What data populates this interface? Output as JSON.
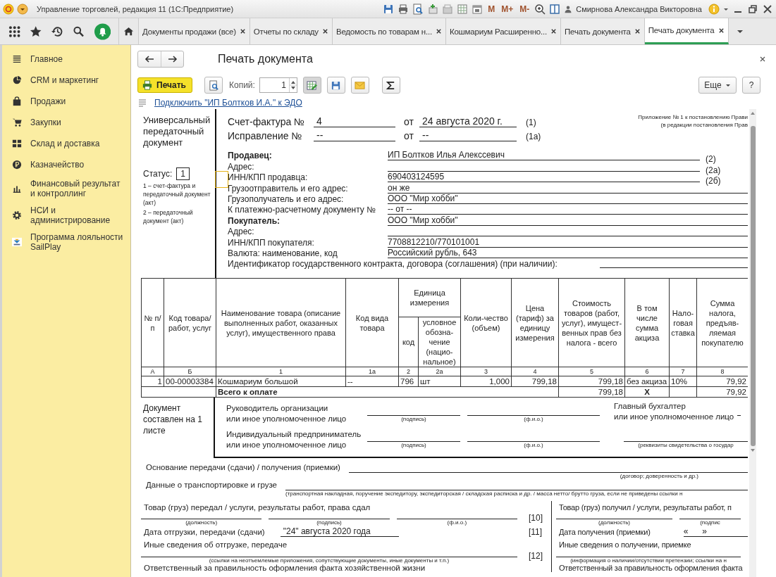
{
  "window": {
    "title": "Управление торговлей, редакция 11 (1С:Предприятие)",
    "memory_buttons": [
      "M",
      "M+",
      "M-"
    ],
    "user": "Смирнова Александра Викторовна"
  },
  "tabs": [
    {
      "label": "Документы продажи (все)",
      "selected": false
    },
    {
      "label": "Отчеты по складу",
      "selected": false
    },
    {
      "label": "Ведомость по товарам н...",
      "selected": false
    },
    {
      "label": "Кошмариум Расширенно...",
      "selected": false
    },
    {
      "label": "Печать документа",
      "selected": false
    },
    {
      "label": "Печать документа",
      "selected": true
    }
  ],
  "sidebar": {
    "items": [
      {
        "label": "Главное",
        "kind": "menu"
      },
      {
        "label": "CRM и маркетинг",
        "kind": "pie"
      },
      {
        "label": "Продажи",
        "kind": "bag"
      },
      {
        "label": "Закупки",
        "kind": "cart"
      },
      {
        "label": "Склад и доставка",
        "kind": "grid"
      },
      {
        "label": "Казначейство",
        "kind": "ruble"
      },
      {
        "label": "Финансовый результат и контроллинг",
        "kind": "chart"
      },
      {
        "label": "НСИ и администрирование",
        "kind": "gear"
      },
      {
        "label": "Программа лояльности SailPlay",
        "kind": "logo"
      }
    ]
  },
  "form": {
    "title": "Печать документа",
    "print_button": "Печать",
    "copies_label": "Копий:",
    "copies_value": "1",
    "more_button": "Еще",
    "help_button": "?",
    "edo_link": "Подключить \"ИП Болтков И.А.\" к ЭДО"
  },
  "document": {
    "left_title": "Универсальный передаточный документ",
    "status_label": "Статус:",
    "status_value": "1",
    "status_notes": [
      "1 – счет-фактура и передаточный документ (акт)",
      "2 – передаточный документ (акт)"
    ],
    "appendix": [
      "Приложение № 1 к постановлению Прави",
      "(в редакции постановления Прав"
    ],
    "header_rows": [
      {
        "label": "Счет-фактура №",
        "number": "4",
        "from": "от",
        "date": "24 августа 2020 г.",
        "ref": "(1)"
      },
      {
        "label": "Исправление №",
        "number": "--",
        "from": "от",
        "date": "--",
        "ref": "(1а)"
      }
    ],
    "fields": [
      {
        "label": "Продавец:",
        "bold": true,
        "value": "ИП Болтков Илья Алекссевич",
        "ref": "(2)"
      },
      {
        "label": "Адрес:",
        "bold": false,
        "ref": "(2а)"
      },
      {
        "label": "ИНН/КПП продавца:",
        "bold": false,
        "value": "690403124595",
        "ref": "(2б)"
      },
      {
        "label": "Грузоотправитель и его адрес:",
        "bold": false,
        "value": "он же"
      },
      {
        "label": "Грузополучатель и его адрес:",
        "bold": false,
        "value": "ООО \"Мир хобби\""
      },
      {
        "label": "К платежно-расчетному документу №",
        "bold": false,
        "value": "-- от --"
      },
      {
        "label": "Покупатель:",
        "bold": true,
        "value": "ООО \"Мир хобби\""
      },
      {
        "label": "Адрес:",
        "bold": false
      },
      {
        "label": "ИНН/КПП покупателя:",
        "bold": false,
        "value": "7708812210/770101001"
      },
      {
        "label": "Валюта: наименование, код",
        "bold": false,
        "value": "Российский рубль, 643"
      },
      {
        "label": "Идентификатор государственного контракта, договора (соглашения) (при наличии):",
        "bold": false,
        "kind": "wide"
      }
    ],
    "table": {
      "columns": [
        {
          "label": "№ п/п"
        },
        {
          "label": "Код товара/ работ, услуг"
        },
        {
          "label": "Наименование товара (описание выполненных работ, оказанных услуг), имущественного права"
        },
        {
          "label": "Код вида товара"
        },
        {
          "label": "Единица измерения",
          "colspan": 2,
          "children": [
            {
              "label": "код"
            },
            {
              "label": "условное обозна-чение (нацио-нальное)"
            }
          ]
        },
        {
          "label": "Коли-чество (объем)"
        },
        {
          "label": "Цена (тариф) за единицу измерения"
        },
        {
          "label": "Стоимость товаров (работ, услуг), имущест-венных прав без налога - всего"
        },
        {
          "label": "В том числе сумма акциза"
        },
        {
          "label": "Нало-говая ставка"
        },
        {
          "label": "Сумма налога, предъяв-ляемая покупателю"
        }
      ],
      "number_row": [
        "А",
        "Б",
        "1",
        "1а",
        "2",
        "2а",
        "3",
        "4",
        "5",
        "6",
        "7",
        "8"
      ],
      "rows": [
        {
          "cells": [
            "1",
            "00-00003384",
            "Кошмариум большой",
            "--",
            "796",
            "шт",
            "1,000",
            "799,18",
            "799,18",
            "без акциза",
            "10%",
            "79,92"
          ]
        }
      ],
      "total": {
        "label": "Всего к оплате",
        "cost": "799,18",
        "excise": "X",
        "tax": "79,92"
      }
    },
    "sheets_note": "Документ составлен на 1 листе",
    "signers": [
      {
        "title": [
          "Руководитель организации",
          "или иное уполномоченное лицо"
        ],
        "captions": [
          "(подпись)",
          "(ф.и.о.)"
        ],
        "extra_title": [
          "Главный бухгалтер",
          "или иное уполномоченное лицо"
        ]
      },
      {
        "title": [
          "Индивидуальный предприниматель",
          "или иное уполномоченное лицо"
        ],
        "captions": [
          "(подпись)",
          "(ф.и.о.)"
        ],
        "extra_caption": "(реквизиты свидетельства о государ"
      }
    ],
    "transfer": {
      "basis": {
        "label": "Основание передачи (сдачи) / получения (приемки)",
        "caption": "(договор; доверенность и др.)"
      },
      "transport": {
        "label": "Данные о транспортировке и грузе",
        "caption": "(транспортная накладная, поручение экспедитору, экспедиторская / складская расписка и др. / масса нетто/ брутто груза, если не приведены ссылки н"
      },
      "sender": {
        "title": "Товар (груз) передал / услуги, результаты работ, права сдал",
        "captions": [
          "(должность)",
          "(подпись)",
          "(ф.и.о.)"
        ],
        "sign_ref": "[10]",
        "date_label": "Дата отгрузки, передачи (сдачи)",
        "date_value": "\"24\" августа 2020 года",
        "date_ref": "[11]",
        "other_label": "Иные сведения об отгрузке, передаче",
        "other_caption": "(ссылки на неотъемлемые приложения, сопутствующие документы, иные документы и т.п.)",
        "other_ref": "[12]",
        "responsible": "Ответственный за правильность оформления факта хозяйственной жизни"
      },
      "receiver": {
        "title": "Товар (груз) получил / услуги, результаты работ, п",
        "captions": [
          "(должность)",
          "(подпис"
        ],
        "date_label": "Дата получения (приемки)",
        "date_value": "«      »",
        "other_label": "Иные сведения о получении, приемке",
        "other_caption": "(информация о наличии/отсутствии претензии; ссылки на н",
        "responsible": "Ответственный за правильность оформления факта"
      }
    }
  }
}
